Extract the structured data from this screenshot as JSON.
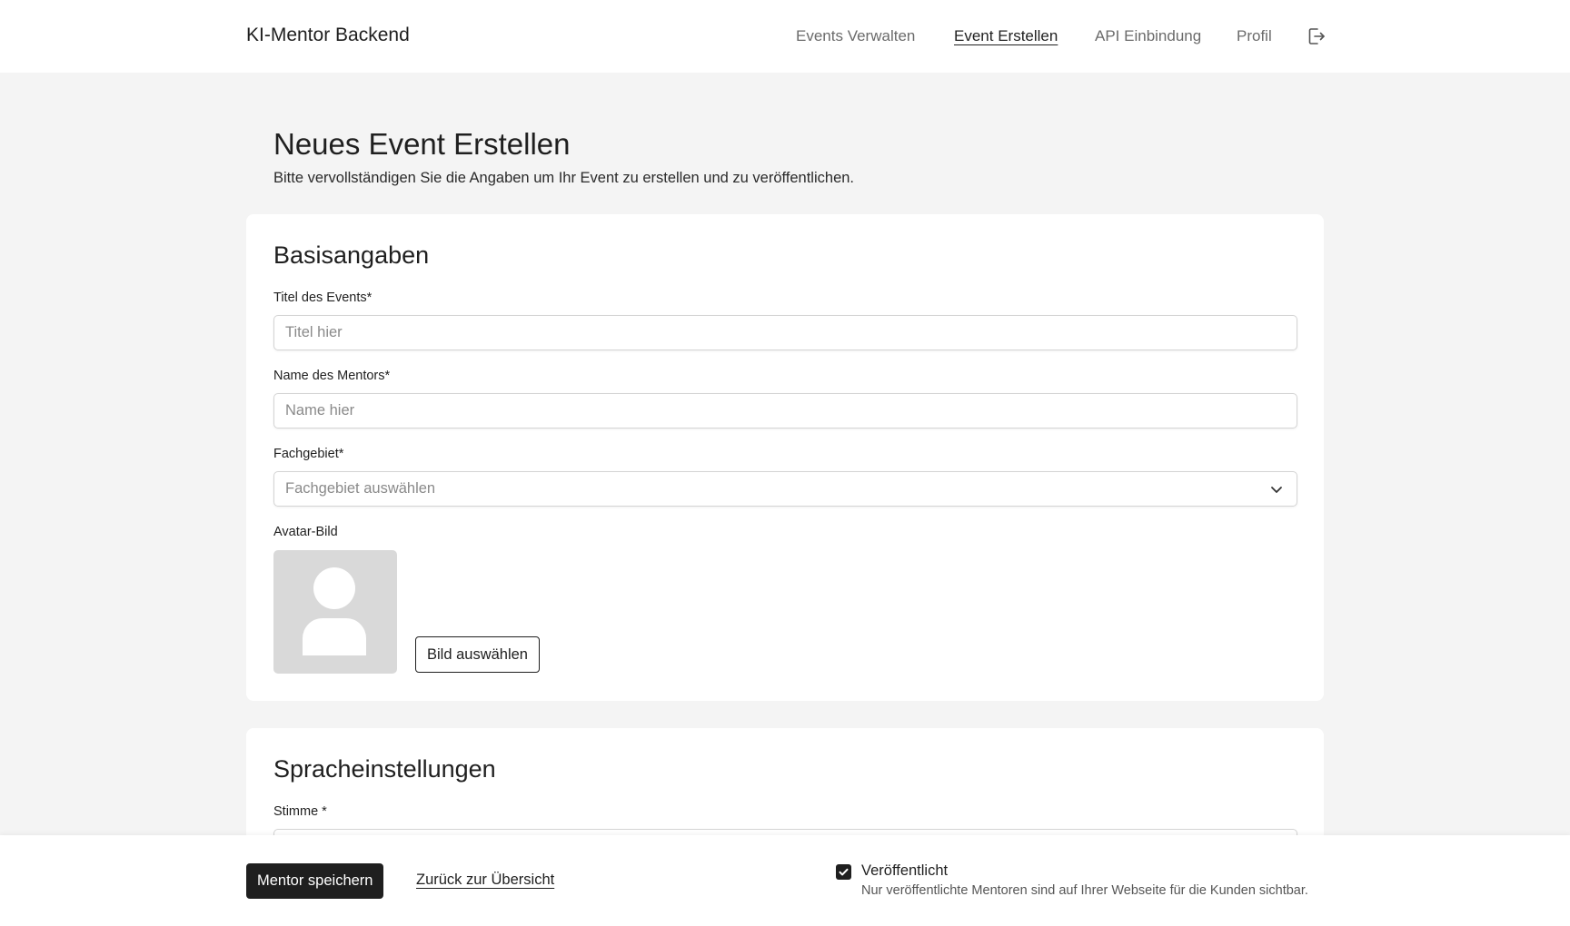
{
  "header": {
    "brand": "KI-Mentor Backend",
    "nav": [
      {
        "label": "Events Verwalten",
        "active": false
      },
      {
        "label": "Event Erstellen",
        "active": true
      },
      {
        "label": "API Einbindung",
        "active": false
      },
      {
        "label": "Profil",
        "active": false
      }
    ],
    "logout_icon": "logout-icon"
  },
  "page": {
    "title": "Neues Event Erstellen",
    "subtitle": "Bitte vervollständigen Sie die Angaben um Ihr Event zu erstellen und zu veröffentlichen."
  },
  "basis": {
    "title": "Basisangaben",
    "event_title": {
      "label": "Titel des Events*",
      "placeholder": "Titel hier",
      "value": ""
    },
    "mentor_name": {
      "label": "Name des Mentors*",
      "placeholder": "Name hier",
      "value": ""
    },
    "field": {
      "label": "Fachgebiet*",
      "placeholder": "Fachgebiet auswählen"
    },
    "avatar": {
      "label": "Avatar-Bild",
      "button": "Bild auswählen",
      "icon": "user-placeholder-icon"
    }
  },
  "speech": {
    "title": "Spracheinstellungen",
    "voice_label": "Stimme *"
  },
  "footer": {
    "save": "Mentor speichern",
    "back": "Zurück zur Übersicht",
    "published": {
      "label": "Veröffentlicht",
      "checked": true,
      "hint": "Nur veröffentlichte Mentoren sind auf Ihrer Webseite für die Kunden sichtbar."
    }
  },
  "colors": {
    "background": "#f4f4f4",
    "surface": "#ffffff",
    "primary": "#1f1f1f",
    "muted_text": "#6b6b6b",
    "border": "#d4d4d4",
    "avatar_bg": "#d9d9d9"
  }
}
